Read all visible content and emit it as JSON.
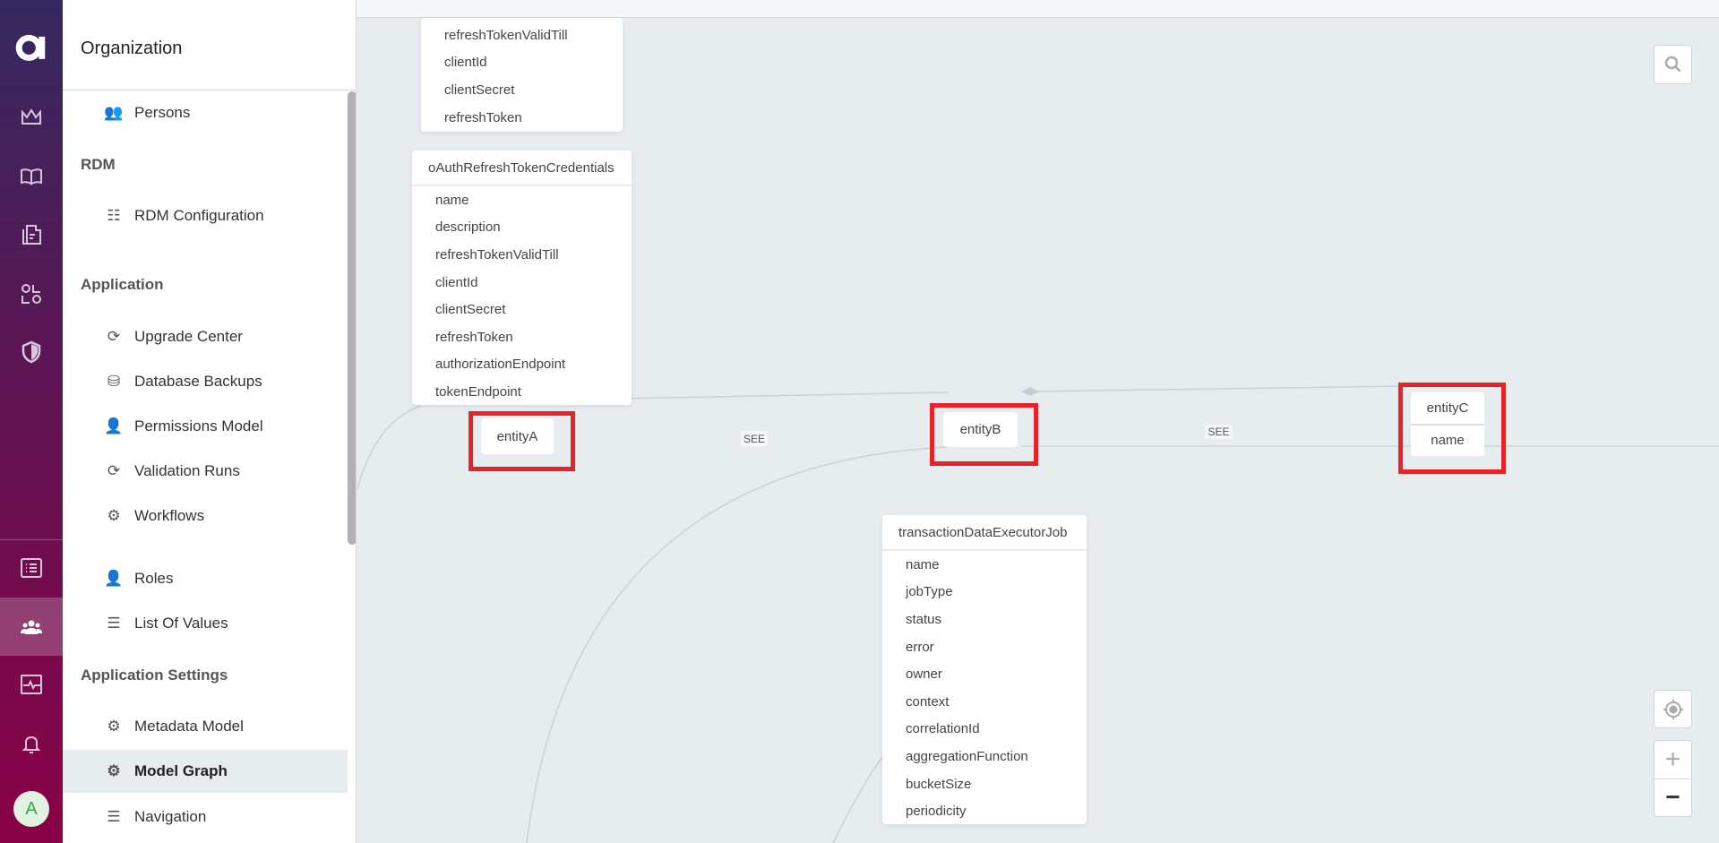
{
  "rail": {
    "logo": "a-logo",
    "icons": [
      "crown-icon",
      "book-icon",
      "documents-icon",
      "shapes-icon",
      "shield-icon",
      "list-icon",
      "people-icon",
      "monitor-icon",
      "bell-icon"
    ],
    "avatar": "A",
    "active": "people-icon"
  },
  "nav": {
    "title": "Organization",
    "sections": {
      "rdm": "RDM",
      "application": "Application",
      "settings": "Application Settings"
    },
    "items": {
      "persons": "Persons",
      "rdm_config": "RDM Configuration",
      "upgrade": "Upgrade Center",
      "backups": "Database Backups",
      "permissions": "Permissions Model",
      "validation": "Validation Runs",
      "workflows": "Workflows",
      "roles": "Roles",
      "lov": "List Of Values",
      "metadata": "Metadata Model",
      "model_graph": "Model Graph",
      "navigation": "Navigation"
    },
    "selected": "Model Graph"
  },
  "graph": {
    "top_card": {
      "rows": [
        "refreshTokenValidTill",
        "clientId",
        "clientSecret",
        "refreshToken"
      ]
    },
    "oauth_card": {
      "title": "oAuthRefreshTokenCredentials",
      "rows": [
        "name",
        "description",
        "refreshTokenValidTill",
        "clientId",
        "clientSecret",
        "refreshToken",
        "authorizationEndpoint",
        "tokenEndpoint"
      ]
    },
    "entityA": {
      "title": "entityA"
    },
    "entityB": {
      "title": "entityB"
    },
    "entityC": {
      "title": "entityC",
      "rows": [
        "name"
      ]
    },
    "edge_labels": [
      "SEE",
      "SEE"
    ],
    "job_card": {
      "title": "transactionDataExecutorJob",
      "rows": [
        "name",
        "jobType",
        "status",
        "error",
        "owner",
        "context",
        "correlationId",
        "aggregationFunction",
        "bucketSize",
        "periodicity"
      ]
    },
    "highlight_color": "#e8212b"
  },
  "controls": {
    "search": "search-icon",
    "locate": "locate-icon",
    "zoom_in": "+",
    "zoom_out": "−"
  }
}
